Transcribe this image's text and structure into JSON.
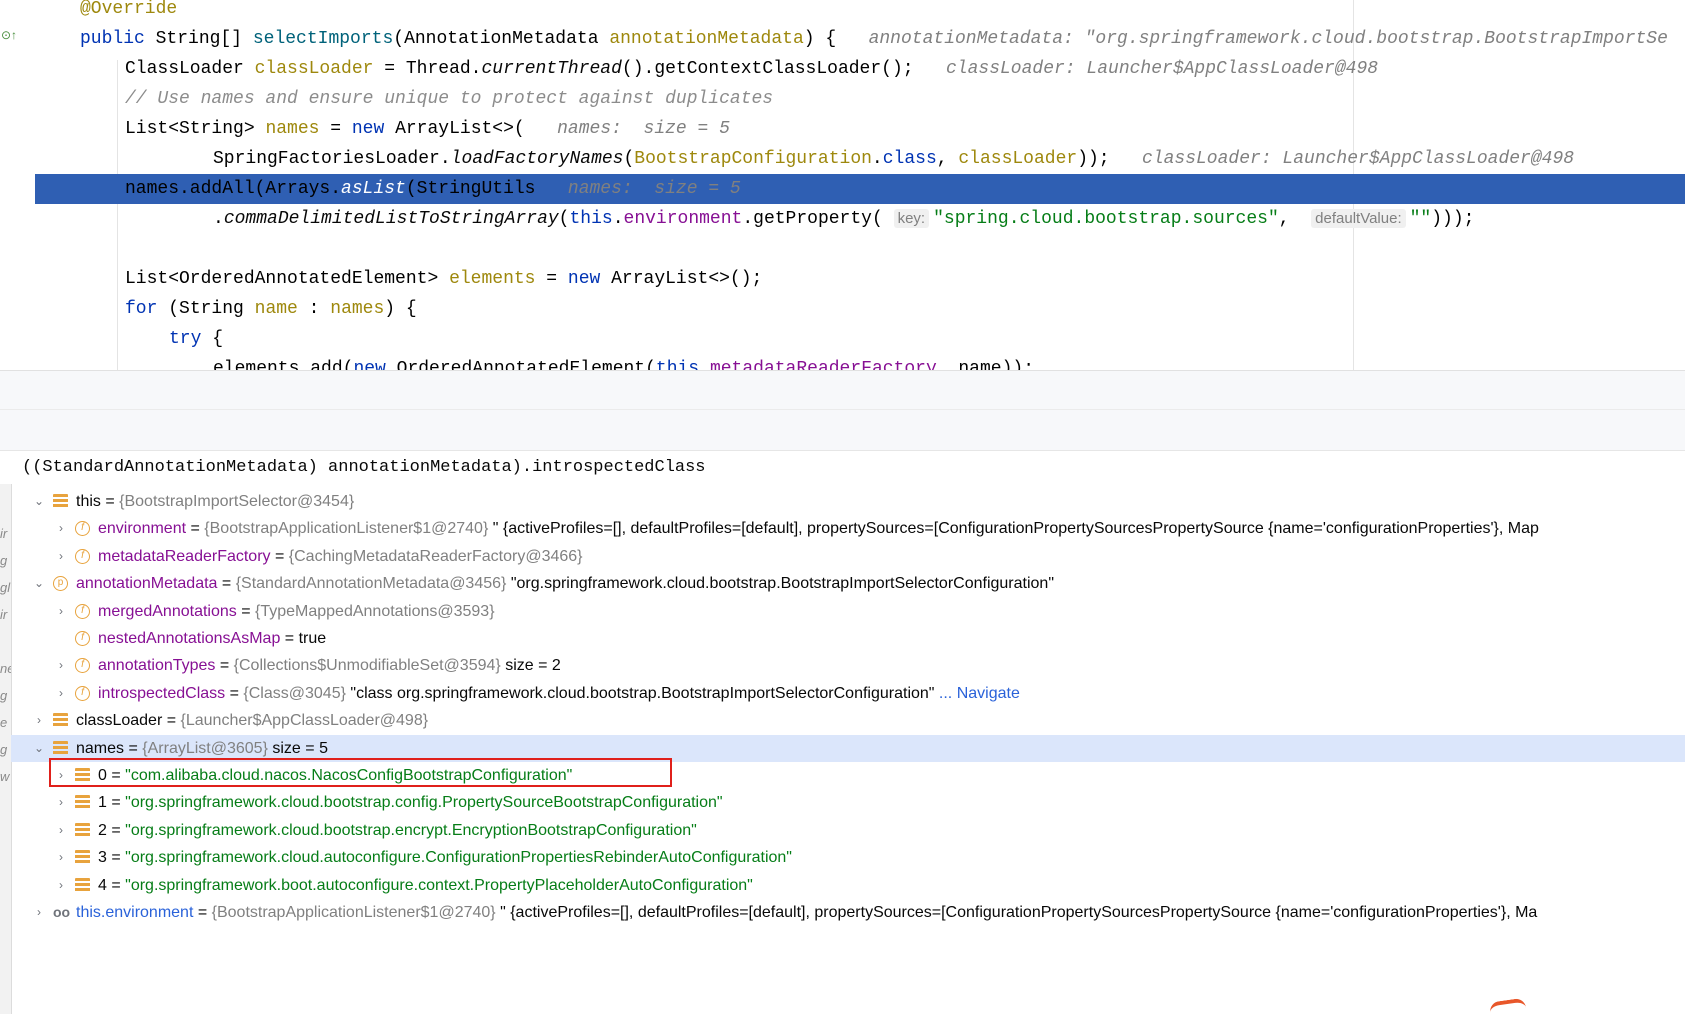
{
  "editor": {
    "lines": [
      {
        "id": "l1",
        "segments": [
          {
            "c": "ann",
            "t": "@Override"
          }
        ]
      },
      {
        "id": "l2",
        "segments": [
          {
            "c": "kw",
            "t": "public "
          },
          {
            "c": "cls",
            "t": "String[] "
          },
          {
            "c": "mth",
            "t": "selectImports"
          },
          {
            "c": "cls",
            "t": "(AnnotationMetadata "
          },
          {
            "c": "ann",
            "t": "annotationMetadata"
          },
          {
            "c": "cls",
            "t": ") {   "
          },
          {
            "c": "hint",
            "t": "annotationMetadata: \"org.springframework.cloud.bootstrap.BootstrapImportSe"
          }
        ]
      },
      {
        "id": "l3",
        "segments": [
          {
            "c": "cls",
            "t": "ClassLoader "
          },
          {
            "c": "ann",
            "t": "classLoader"
          },
          {
            "c": "cls",
            "t": " = Thread."
          },
          {
            "c": "it",
            "t": "currentThread"
          },
          {
            "c": "cls",
            "t": "().getContextClassLoader();   "
          },
          {
            "c": "hint",
            "t": "classLoader: Launcher$AppClassLoader@498"
          }
        ]
      },
      {
        "id": "l4",
        "segments": [
          {
            "c": "cmt",
            "t": "// Use names and ensure unique to protect against duplicates"
          }
        ]
      },
      {
        "id": "l5",
        "segments": [
          {
            "c": "cls",
            "t": "List<String> "
          },
          {
            "c": "ann",
            "t": "names"
          },
          {
            "c": "cls",
            "t": " = "
          },
          {
            "c": "kw",
            "t": "new "
          },
          {
            "c": "cls",
            "t": "ArrayList<>(   "
          },
          {
            "c": "hint",
            "t": "names:  size = 5"
          }
        ]
      },
      {
        "id": "l6",
        "segments": [
          {
            "c": "cls",
            "t": "SpringFactoriesLoader."
          },
          {
            "c": "it",
            "t": "loadFactoryNames"
          },
          {
            "c": "cls",
            "t": "("
          },
          {
            "c": "ann",
            "t": "BootstrapConfiguration"
          },
          {
            "c": "cls",
            "t": "."
          },
          {
            "c": "kw",
            "t": "class"
          },
          {
            "c": "cls",
            "t": ", "
          },
          {
            "c": "ann",
            "t": "classLoader"
          },
          {
            "c": "cls",
            "t": "));   "
          },
          {
            "c": "hint",
            "t": "classLoader: Launcher$AppClassLoader@498"
          }
        ]
      },
      {
        "id": "l7",
        "segments": [
          {
            "c": "cls",
            "t": "names.addAll(Arrays."
          },
          {
            "c": "it",
            "t": "asList"
          },
          {
            "c": "cls",
            "t": "(StringUtils   "
          },
          {
            "c": "hint",
            "t": "names:  size = 5"
          }
        ]
      },
      {
        "id": "l8",
        "segments": [
          {
            "c": "cls",
            "t": "."
          },
          {
            "c": "it",
            "t": "commaDelimitedListToStringArray"
          },
          {
            "c": "cls",
            "t": "("
          },
          {
            "c": "kw",
            "t": "this"
          },
          {
            "c": "cls",
            "t": "."
          },
          {
            "c": "fld",
            "t": "environment"
          },
          {
            "c": "cls",
            "t": ".getProperty( "
          },
          {
            "c": "phint",
            "t": "key:"
          },
          {
            "c": "str",
            "t": "\"spring.cloud.bootstrap.sources\""
          },
          {
            "c": "cls",
            "t": ",  "
          },
          {
            "c": "phint",
            "t": "defaultValue:"
          },
          {
            "c": "str",
            "t": "\"\""
          },
          {
            "c": "cls",
            "t": ")));"
          }
        ]
      },
      {
        "id": "l9",
        "segments": []
      },
      {
        "id": "l10",
        "segments": [
          {
            "c": "cls",
            "t": "List<OrderedAnnotatedElement> "
          },
          {
            "c": "ann",
            "t": "elements"
          },
          {
            "c": "cls",
            "t": " = "
          },
          {
            "c": "kw",
            "t": "new "
          },
          {
            "c": "cls",
            "t": "ArrayList<>();"
          }
        ]
      },
      {
        "id": "l11",
        "segments": [
          {
            "c": "kw",
            "t": "for "
          },
          {
            "c": "cls",
            "t": "(String "
          },
          {
            "c": "ann",
            "t": "name"
          },
          {
            "c": "cls",
            "t": " : "
          },
          {
            "c": "ann",
            "t": "names"
          },
          {
            "c": "cls",
            "t": ") {"
          }
        ]
      },
      {
        "id": "l12",
        "segments": [
          {
            "c": "kw",
            "t": "try "
          },
          {
            "c": "cls",
            "t": "{"
          }
        ]
      },
      {
        "id": "l13",
        "segments": [
          {
            "c": "cls",
            "t": "elements.add("
          },
          {
            "c": "kw",
            "t": "new "
          },
          {
            "c": "cls",
            "t": "OrderedAnnotatedElement("
          },
          {
            "c": "kw",
            "t": "this"
          },
          {
            "c": "cls",
            "t": "."
          },
          {
            "c": "fld",
            "t": "metadataReaderFactory"
          },
          {
            "c": "cls",
            "t": ", name));"
          }
        ]
      }
    ]
  },
  "debugger": {
    "expression": "((StandardAnnotationMetadata) annotationMetadata).introspectedClass",
    "rows": [
      {
        "name": "this",
        "ref": "{BootstrapImportSelector@3454}",
        "value": ""
      },
      {
        "name": "environment",
        "ref": "{BootstrapApplicationListener$1@2740}",
        "value": "\" {activeProfiles=[], defaultProfiles=[default], propertySources=[ConfigurationPropertySourcesPropertySource {name='configurationProperties'}, Map"
      },
      {
        "name": "metadataReaderFactory",
        "ref": "{CachingMetadataReaderFactory@3466}",
        "value": ""
      },
      {
        "name": "annotationMetadata",
        "ref": "{StandardAnnotationMetadata@3456}",
        "value": "\"org.springframework.cloud.bootstrap.BootstrapImportSelectorConfiguration\""
      },
      {
        "name": "mergedAnnotations",
        "ref": "{TypeMappedAnnotations@3593}",
        "value": ""
      },
      {
        "name": "nestedAnnotationsAsMap",
        "ref": "",
        "value": "true"
      },
      {
        "name": "annotationTypes",
        "ref": "{Collections$UnmodifiableSet@3594}",
        "value": "size = 2"
      },
      {
        "name": "introspectedClass",
        "ref": "{Class@3045}",
        "value": "\"class org.springframework.cloud.bootstrap.BootstrapImportSelectorConfiguration\"",
        "nav": "... Navigate"
      },
      {
        "name": "classLoader",
        "ref": "{Launcher$AppClassLoader@498}",
        "value": ""
      },
      {
        "name": "names",
        "ref": "{ArrayList@3605}",
        "value": "size = 5"
      },
      {
        "name": "0",
        "ref": "",
        "value": "\"com.alibaba.cloud.nacos.NacosConfigBootstrapConfiguration\""
      },
      {
        "name": "1",
        "ref": "",
        "value": "\"org.springframework.cloud.bootstrap.config.PropertySourceBootstrapConfiguration\""
      },
      {
        "name": "2",
        "ref": "",
        "value": "\"org.springframework.cloud.bootstrap.encrypt.EncryptionBootstrapConfiguration\""
      },
      {
        "name": "3",
        "ref": "",
        "value": "\"org.springframework.cloud.autoconfigure.ConfigurationPropertiesRebinderAutoConfiguration\""
      },
      {
        "name": "4",
        "ref": "",
        "value": "\"org.springframework.boot.autoconfigure.context.PropertyPlaceholderAutoConfiguration\""
      },
      {
        "name": "this.environment",
        "ref": "{BootstrapApplicationListener$1@2740}",
        "value": "\" {activeProfiles=[], defaultProfiles=[default], propertySources=[ConfigurationPropertySourcesPropertySource {name='configurationProperties'}, Ma"
      }
    ]
  },
  "icons": {
    "override_marker": "implementation-gutter-icon",
    "field": "f",
    "param": "p",
    "watch": "oo"
  },
  "colors": {
    "selection": "#2f5fb3",
    "row_selected": "#dbe6fb",
    "highlight_box": "#e0201b"
  }
}
